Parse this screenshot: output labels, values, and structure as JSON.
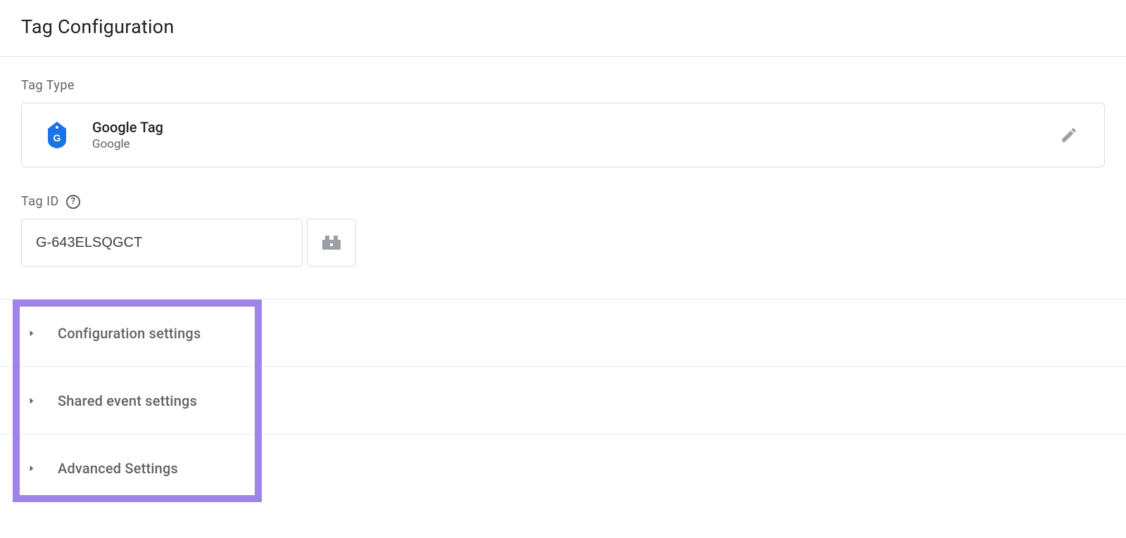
{
  "header": {
    "title": "Tag Configuration"
  },
  "tagType": {
    "label": "Tag Type",
    "name": "Google Tag",
    "vendor": "Google",
    "iconName": "google-tag-icon"
  },
  "tagId": {
    "label": "Tag ID",
    "value": "G-643ELSQGCT"
  },
  "accordions": [
    {
      "label": "Configuration settings"
    },
    {
      "label": "Shared event settings"
    },
    {
      "label": "Advanced Settings"
    }
  ]
}
